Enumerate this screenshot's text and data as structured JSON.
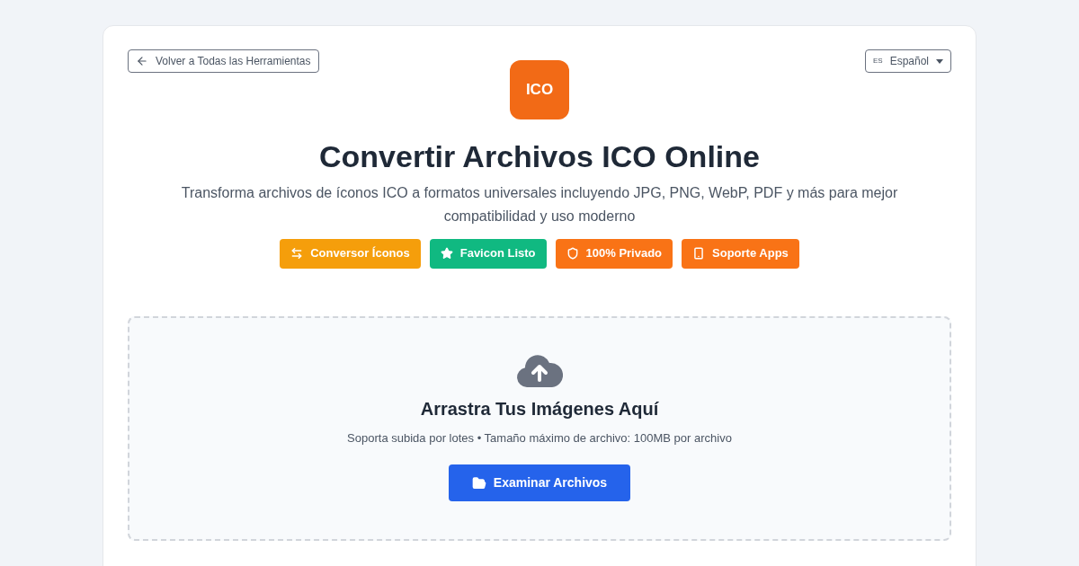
{
  "back_link": {
    "label": "Volver a Todas las Herramientas"
  },
  "language": {
    "code": "ES",
    "label": "Español"
  },
  "logo": {
    "text": "ICO"
  },
  "title": "Convertir Archivos ICO Online",
  "subtitle": "Transforma archivos de íconos ICO a formatos universales incluyendo JPG, PNG, WebP, PDF y más para mejor compatibilidad y uso moderno",
  "badges": [
    {
      "label": "Conversor Íconos",
      "color": "#f59e0b"
    },
    {
      "label": "Favicon Listo",
      "color": "#10b981"
    },
    {
      "label": "100% Privado",
      "color": "#f97316"
    },
    {
      "label": "Soporte Apps",
      "color": "#f97316"
    }
  ],
  "dropzone": {
    "title": "Arrastra Tus Imágenes Aquí",
    "hint": "Soporta subida por lotes • Tamaño máximo de archivo: 100MB por archivo",
    "button": "Examinar Archivos"
  }
}
